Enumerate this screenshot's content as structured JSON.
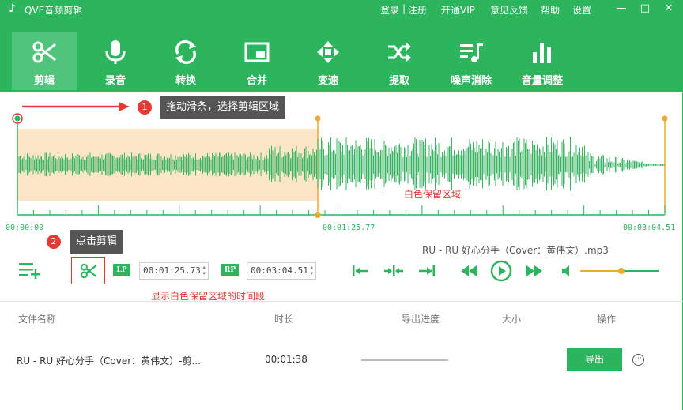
{
  "app": {
    "title": "QVE音频剪辑",
    "icon": "music-note-icon"
  },
  "top_links": {
    "login": "登录",
    "sep": "|",
    "register": "注册",
    "vip": "开通VIP",
    "feedback": "意见反馈",
    "help": "帮助",
    "settings": "设置"
  },
  "window": {
    "minimize": "—",
    "maximize": "□",
    "close": "✕"
  },
  "toolbar": [
    {
      "label": "剪辑",
      "icon": "scissors-icon",
      "active": true
    },
    {
      "label": "录音",
      "icon": "microphone-icon"
    },
    {
      "label": "转换",
      "icon": "convert-icon"
    },
    {
      "label": "合并",
      "icon": "merge-icon"
    },
    {
      "label": "变速",
      "icon": "speed-icon"
    },
    {
      "label": "提取",
      "icon": "extract-icon"
    },
    {
      "label": "噪声消除",
      "icon": "noise-removal-icon"
    },
    {
      "label": "音量调整",
      "icon": "volume-bars-icon"
    }
  ],
  "editor": {
    "tip1_step": "1",
    "tip1_text": "拖动滑条，选择剪辑区域",
    "white_region": "白色保留区域",
    "time_start": "00:00:00",
    "time_mid": "00:01:25.77",
    "time_end": "00:03:04.51",
    "tip2_step": "2",
    "tip2_text": "点击剪辑",
    "filename": "RU - RU 好心分手（Cover：黄伟文）.mp3",
    "lp_tag": "LP",
    "rp_tag": "RP",
    "lp_value": "00:01:25.73",
    "rp_value": "00:03:04.51",
    "hint": "显示白色保留区域的时间段",
    "volume_level": 0.52
  },
  "colors": {
    "brand": "#2db55d",
    "accent": "#e53935",
    "handle": "#f0a830",
    "selection": "#fde5c8"
  },
  "table": {
    "headers": {
      "name": "文件名称",
      "duration": "时长",
      "progress": "导出进度",
      "size": "大小",
      "action": "操作"
    },
    "rows": [
      {
        "name": "RU - RU 好心分手（Cover：黄伟文）-剪...",
        "duration": "00:01:38",
        "progress": 0,
        "size": "",
        "export": "导出",
        "more": "···"
      }
    ]
  }
}
